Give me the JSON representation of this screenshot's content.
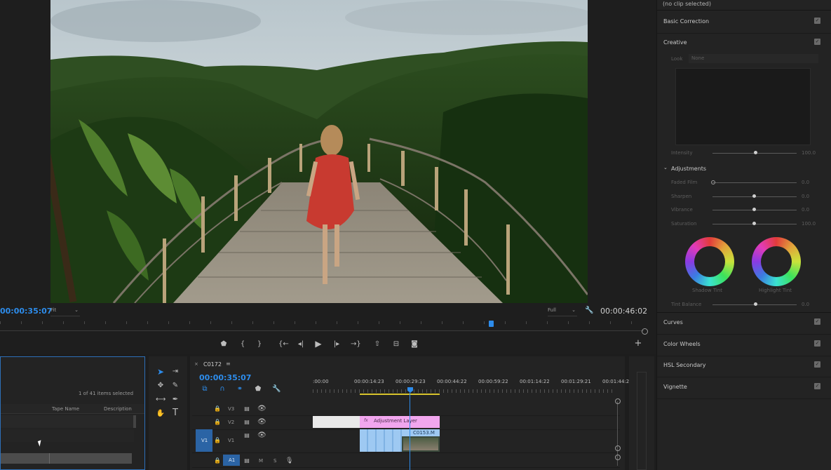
{
  "program_monitor": {
    "current_time": "00:00:35:07",
    "fit_label": "Fit",
    "quality_label": "Full",
    "duration": "00:00:46:02"
  },
  "lumetri": {
    "header": "(no clip selected)",
    "basic_correction": "Basic Correction",
    "creative": "Creative",
    "look_label": "Look",
    "look_value": "None",
    "intensity_label": "Intensity",
    "intensity_value": "100.0",
    "adjustments": "Adjustments",
    "sliders": [
      {
        "label": "Faded Film",
        "value": "0.0",
        "level": 0.0
      },
      {
        "label": "Sharpen",
        "value": "0.0",
        "level": 0.5
      },
      {
        "label": "Vibrance",
        "value": "0.0",
        "level": 0.5
      },
      {
        "label": "Saturation",
        "value": "100.0",
        "level": 0.5
      }
    ],
    "shadow_tint": "Shadow Tint",
    "highlight_tint": "Highlight Tint",
    "tint_balance_label": "Tint Balance",
    "tint_balance_value": "0.0",
    "sections": [
      "Curves",
      "Color Wheels",
      "HSL Secondary",
      "Vignette"
    ]
  },
  "project_panel": {
    "items_selected": "1 of 41 items selected",
    "col_tape_name": "Tape Name",
    "col_description": "Description"
  },
  "timeline": {
    "sequence_name": "C0172",
    "timecode": "00:00:35:07",
    "ruler_ticks": [
      ":00:00",
      "00:00:14:23",
      "00:00:29:23",
      "00:00:44:22",
      "00:00:59:22",
      "00:01:14:22",
      "00:01:29:21",
      "00:01:44:2"
    ],
    "tracks": [
      "V3",
      "V2",
      "V1",
      "A1"
    ],
    "track_labels": {
      "v1_source": "V1",
      "a1_source": "A1",
      "mute": "M",
      "solo": "S"
    },
    "adjustment_clip": "Adjustment Layer",
    "video_clip": "C0153.M",
    "fx_badge": "fx"
  },
  "colors": {
    "accent_blue": "#2d8ceb",
    "adjustment_clip": "#f1a6ee",
    "video_clip": "#9ec9f2",
    "work_area": "#d8c42c"
  }
}
